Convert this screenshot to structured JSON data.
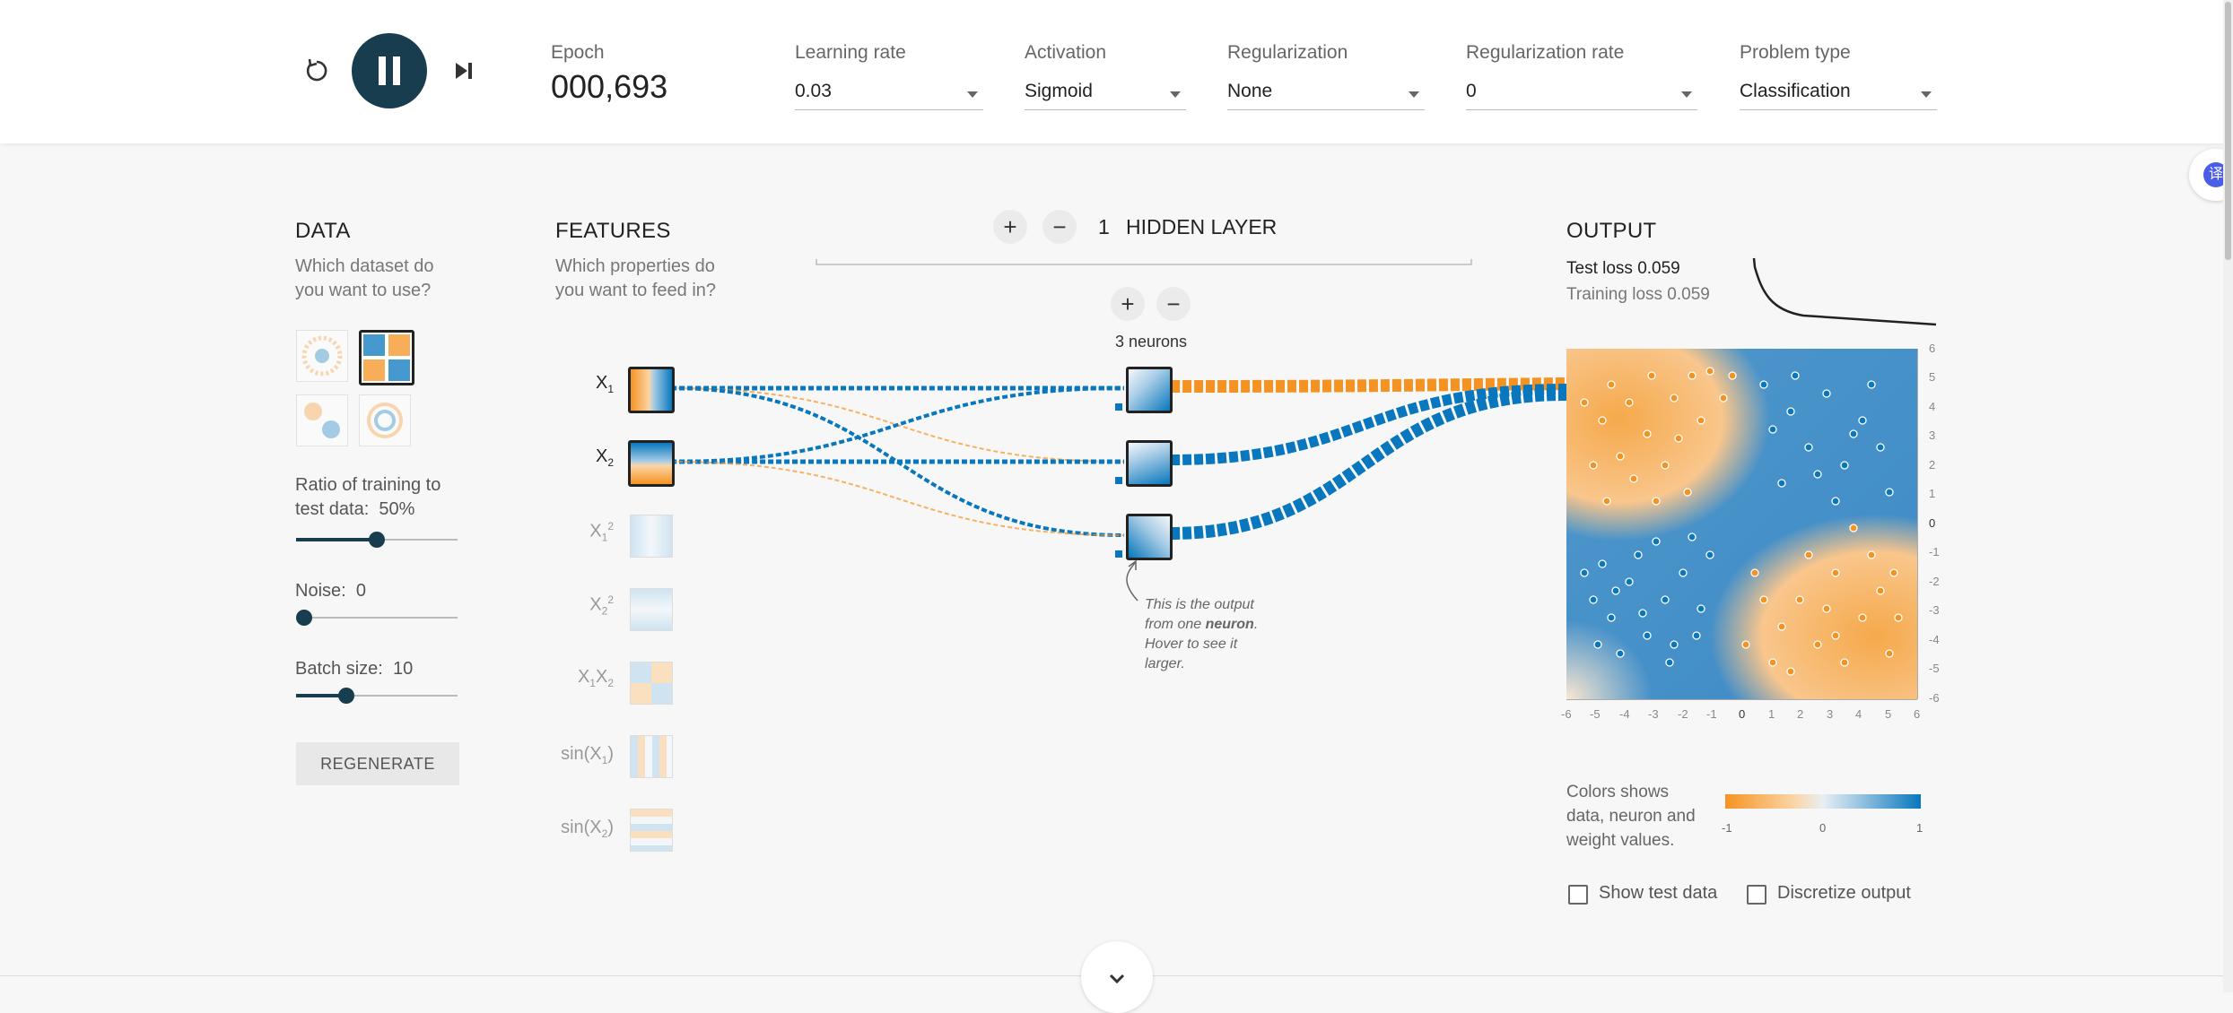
{
  "header": {
    "epoch_label": "Epoch",
    "epoch_value": "000,693",
    "learning_rate": {
      "label": "Learning rate",
      "value": "0.03"
    },
    "activation": {
      "label": "Activation",
      "value": "Sigmoid"
    },
    "regularization": {
      "label": "Regularization",
      "value": "None"
    },
    "regularization_rate": {
      "label": "Regularization rate",
      "value": "0"
    },
    "problem_type": {
      "label": "Problem type",
      "value": "Classification"
    }
  },
  "data_panel": {
    "title": "DATA",
    "question_line1": "Which dataset do",
    "question_line2": "you want to use?",
    "ratio_label_line1": "Ratio of training to",
    "ratio_label_line2": "test data:",
    "ratio_value": "50%",
    "ratio_fraction": 0.5,
    "noise_label": "Noise:",
    "noise_value": "0",
    "noise_fraction": 0,
    "batch_label": "Batch size:",
    "batch_value": "10",
    "batch_fraction": 0.31,
    "regenerate": "REGENERATE"
  },
  "features_panel": {
    "title": "FEATURES",
    "question_line1": "Which properties do",
    "question_line2": "you want to feed in?"
  },
  "network": {
    "layer_count": "1",
    "layer_label": "HIDDEN LAYER",
    "neurons_label": "3 neurons",
    "plus": "+",
    "minus": "−",
    "callout": [
      "This is the output",
      "from one",
      "neuron",
      ".",
      "Hover to see it",
      "larger."
    ]
  },
  "output_panel": {
    "title": "OUTPUT",
    "test_loss": "Test loss 0.059",
    "training_loss": "Training loss 0.059",
    "legend_line1": "Colors shows",
    "legend_line2": "data, neuron and",
    "legend_line3": "weight values.",
    "legend_min": "-1",
    "legend_mid": "0",
    "legend_max": "1",
    "show_test_data": "Show test data",
    "discretize_output": "Discretize output",
    "y_ticks": [
      "6",
      "5",
      "4",
      "3",
      "2",
      "1",
      "0",
      "-1",
      "-2",
      "-3",
      "-4",
      "-5",
      "-6"
    ],
    "x_ticks": [
      "-6",
      "-5",
      "-4",
      "-3",
      "-2",
      "-1",
      "0",
      "1",
      "2",
      "3",
      "4",
      "5",
      "6"
    ]
  },
  "colors": {
    "orange": "#f59322",
    "blue": "#0877bd",
    "dark": "#183d4e"
  }
}
